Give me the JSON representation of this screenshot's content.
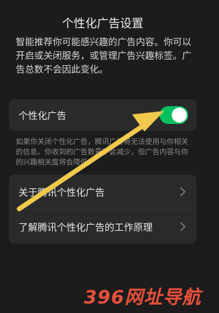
{
  "header": {
    "title": "个性化广告设置"
  },
  "intro": "智能推荐你可能感兴趣的广告内容。你可以开启或关闭服务，或管理广告兴趣标签。广告总数不会因此变化。",
  "toggle_row": {
    "label": "个性化广告",
    "enabled": true
  },
  "note": "如果你关闭个性化广告，腾讯广告将无法使用与你相关的信息。你收到的广告数量不会减少，但广告内容与你的兴趣相关度将会降低。",
  "links": [
    {
      "label": "关于腾讯个性化广告"
    },
    {
      "label": "了解腾讯个性化广告的工作原理"
    }
  ],
  "watermark": "396网址导航",
  "colors": {
    "toggle_on": "#07c160",
    "arrow": "#f2c94c",
    "watermark": "#e9503a"
  }
}
